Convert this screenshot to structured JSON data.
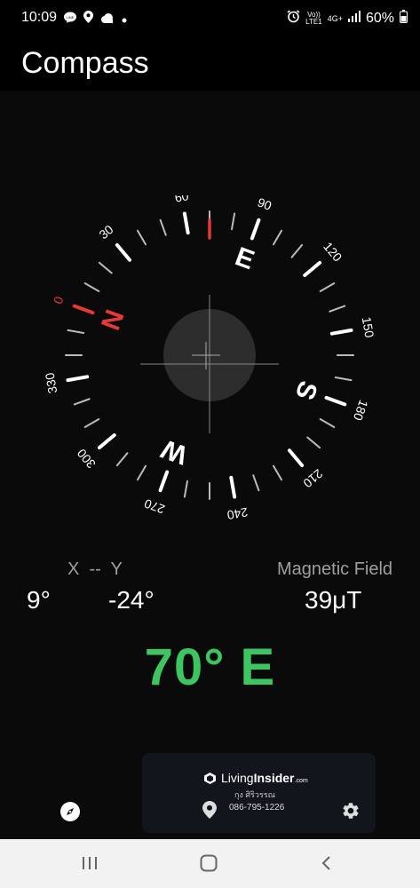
{
  "status": {
    "time": "10:09",
    "volte_line1": "Vo))",
    "volte_line2": "LTE1",
    "network": "4G+",
    "battery": "60%"
  },
  "app": {
    "title": "Compass"
  },
  "compass": {
    "degree_labels": [
      "0",
      "30",
      "60",
      "90",
      "120",
      "150",
      "180",
      "210",
      "240",
      "270",
      "300",
      "330"
    ],
    "cardinals": [
      "N",
      "E",
      "S",
      "W"
    ],
    "rotation_deg": -70
  },
  "readings": {
    "xy_label": "X  --  Y",
    "x_value": "9°",
    "y_value": "-24°",
    "magnetic_label": "Magnetic Field",
    "magnetic_value": "39μT",
    "heading": "70° E"
  },
  "ad": {
    "brand_prefix": "Living",
    "brand_bold": "Insider",
    "brand_suffix": ".com",
    "name": "กุง ศิริวรรณ",
    "phone": "086-795-1226"
  },
  "colors": {
    "accent_green": "#3cc561",
    "north_red": "#e53935"
  },
  "icons": [
    "line-icon",
    "location-icon",
    "cloud-icon",
    "alarm-icon",
    "signal-icon",
    "battery-icon",
    "compass-icon",
    "settings-icon",
    "recents-icon",
    "home-icon",
    "back-icon"
  ]
}
